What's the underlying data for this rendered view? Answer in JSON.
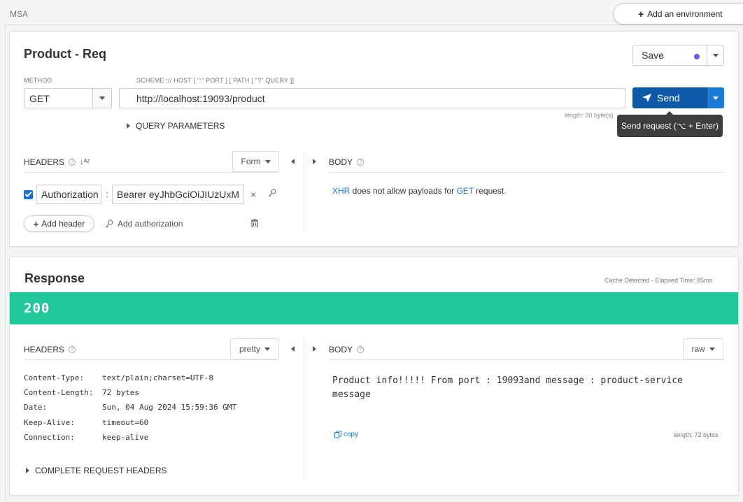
{
  "breadcrumb": "MSA",
  "env_button": {
    "plus": "+",
    "label": "Add an environment"
  },
  "request": {
    "title": "Product - Req",
    "save_label": "Save",
    "method_label": "METHOD",
    "method_value": "GET",
    "url_label": "SCHEME :// HOST [ \":\" PORT ] [ PATH [ \"?\" QUERY ]]",
    "url_value": "http://localhost:19093/product",
    "send_label": "Send",
    "url_length": "length: 30 byte(s)",
    "tooltip": "Send request (⌥ + Enter)",
    "query_params_label": "QUERY PARAMETERS",
    "headers_label": "HEADERS",
    "headers_mode": "Form",
    "header_rows": [
      {
        "enabled": true,
        "name": "Authorization",
        "value": "Bearer eyJhbGciOiJIUzUxM"
      }
    ],
    "add_header_label": "Add header",
    "add_authorization_label": "Add authorization",
    "body_label": "BODY",
    "body_note": {
      "xhr": "XHR",
      "middle": " does not allow payloads for ",
      "method": "GET",
      "end": " request."
    }
  },
  "response": {
    "title": "Response",
    "meta": "Cache Detected - Elapsed Time: 85ms",
    "status_code": "200",
    "headers_label": "HEADERS",
    "headers_mode": "pretty",
    "headers": [
      {
        "key": "Content-Type:",
        "value": "text/plain;charset=UTF-8"
      },
      {
        "key": "Content-Length:",
        "value": "72 bytes"
      },
      {
        "key": "Date:",
        "value": "Sun, 04 Aug 2024 15:59:36 GMT"
      },
      {
        "key": "Keep-Alive:",
        "value": "timeout=60"
      },
      {
        "key": "Connection:",
        "value": "keep-alive"
      }
    ],
    "complete_headers_label": "COMPLETE REQUEST HEADERS",
    "body_label": "BODY",
    "body_mode": "raw",
    "body_text": "Product info!!!!! From port : 19093and message : product-service message",
    "copy_label": "copy",
    "body_length": "length: 72 bytes"
  },
  "colors": {
    "send": "#0f5aa8",
    "status_ok": "#1fc79b",
    "link": "#1a7ad6",
    "save_dot": "#6b5ce7"
  }
}
